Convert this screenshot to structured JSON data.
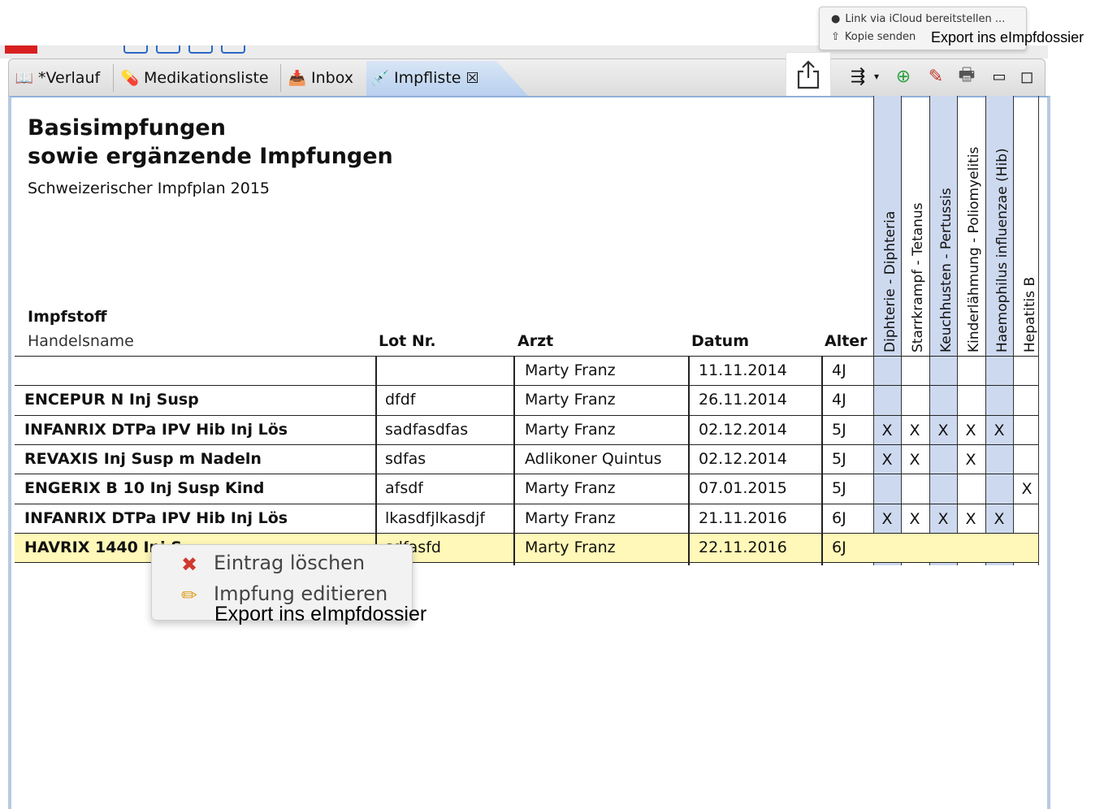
{
  "share_menu": {
    "items": [
      {
        "label": "Link via iCloud bereitstellen ...",
        "icon": "person-icon"
      },
      {
        "label": "Kopie senden",
        "icon": "share-icon"
      }
    ],
    "submenu_label": "Export ins eImpfdossier"
  },
  "tabs": [
    {
      "label": "*Verlauf",
      "icon": "book-icon"
    },
    {
      "label": "Medikationsliste",
      "icon": "pill-icon"
    },
    {
      "label": "Inbox",
      "icon": "inbox-icon"
    },
    {
      "label": "Impfliste",
      "icon": "syringe-icon",
      "active": true,
      "close_icon": "close-icon"
    }
  ],
  "toolbar_icons": [
    "share-icon",
    "filter-icon",
    "add-icon",
    "print-icon",
    "minimize-icon",
    "maximize-icon"
  ],
  "document": {
    "title_line1": "Basisimpfungen",
    "title_line2": "sowie ergänzende Impfungen",
    "subtitle": "Schweizerischer Impfplan 2015"
  },
  "table": {
    "headers": {
      "impfstoff": "Impfstoff",
      "handelsname": "Handelsname",
      "lot": "Lot Nr.",
      "arzt": "Arzt",
      "datum": "Datum",
      "alter": "Alter"
    },
    "diseases": [
      "Diphterie - Diphteria",
      "Starrkrampf - Tetanus",
      "Keuchhusten - Pertussis",
      "Kinderlähmung - Poliomyelitis",
      "Haemophilus influenzae (Hib)",
      "Hepatitis B"
    ],
    "rows": [
      {
        "name": "",
        "lot": "",
        "arzt": "Marty Franz",
        "datum": "11.11.2014",
        "alter": "4J",
        "marks": [
          "",
          "",
          "",
          "",
          "",
          ""
        ]
      },
      {
        "name": "ENCEPUR N Inj Susp",
        "lot": "dfdf",
        "arzt": "Marty Franz",
        "datum": "26.11.2014",
        "alter": "4J",
        "marks": [
          "",
          "",
          "",
          "",
          "",
          ""
        ]
      },
      {
        "name": "INFANRIX DTPa IPV Hib Inj Lös",
        "lot": "sadfasdfas",
        "arzt": "Marty Franz",
        "datum": "02.12.2014",
        "alter": "5J",
        "marks": [
          "X",
          "X",
          "X",
          "X",
          "X",
          ""
        ]
      },
      {
        "name": "REVAXIS Inj Susp m Nadeln",
        "lot": "sdfas",
        "arzt": "Adlikoner Quintus",
        "datum": "02.12.2014",
        "alter": "5J",
        "marks": [
          "X",
          "X",
          "",
          "X",
          "",
          ""
        ]
      },
      {
        "name": "ENGERIX B 10 Inj Susp Kind",
        "lot": "afsdf",
        "arzt": "Marty Franz",
        "datum": "07.01.2015",
        "alter": "5J",
        "marks": [
          "",
          "",
          "",
          "",
          "",
          "X"
        ]
      },
      {
        "name": "INFANRIX DTPa IPV Hib Inj Lös",
        "lot": "lkasdfjlkasdjf",
        "arzt": "Marty Franz",
        "datum": "21.11.2016",
        "alter": "6J",
        "marks": [
          "X",
          "X",
          "X",
          "X",
          "X",
          ""
        ]
      },
      {
        "name": "HAVRIX 1440 Inj S",
        "lot": "sdfasfd",
        "arzt": "Marty Franz",
        "datum": "22.11.2016",
        "alter": "6J",
        "marks": [
          "",
          "",
          "",
          "",
          "",
          ""
        ],
        "selected": true
      }
    ]
  },
  "context_menu": {
    "items": [
      {
        "label": "Eintrag löschen",
        "icon": "delete-icon"
      },
      {
        "label": "Impfung editieren",
        "icon": "pencil-icon"
      }
    ],
    "extra_label": "Export ins eImpfdossier"
  }
}
